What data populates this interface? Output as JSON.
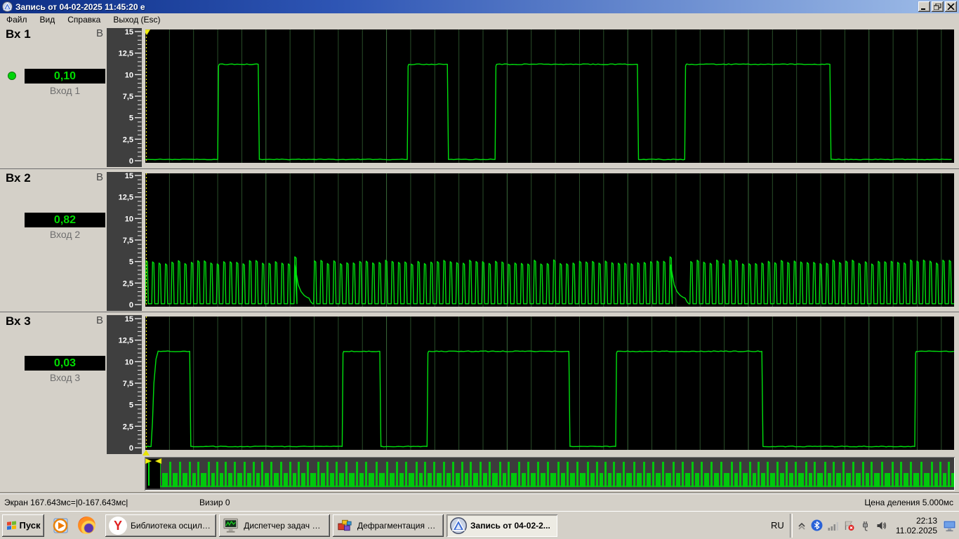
{
  "window": {
    "title": "Запись от 04-02-2025 11:45:20 е",
    "app_icon": "oscilloscope-app-icon",
    "buttons": [
      "minimize",
      "restore",
      "close"
    ]
  },
  "menu": {
    "items": [
      "Файл",
      "Вид",
      "Справка",
      "Выход (Esc)"
    ]
  },
  "status_bar": {
    "screen_info": "Экран 167.643мс=|0-167.643мс|",
    "cursor_info": "Визир 0",
    "division_info": "Цена деления 5.000мс"
  },
  "taskbar": {
    "start_label": "Пуск",
    "quick_launch": [
      "media-player-icon",
      "firefox-icon"
    ],
    "buttons": [
      {
        "label": "Библиотека осцилло...",
        "icon": "yandex-browser-icon",
        "active": false
      },
      {
        "label": "Диспетчер задач Wi...",
        "icon": "task-manager-icon",
        "active": false
      },
      {
        "label": "Дефрагментация ди...",
        "icon": "disk-defrag-icon",
        "active": false
      },
      {
        "label": "Запись от 04-02-2...",
        "icon": "oscilloscope-app-icon",
        "active": true
      }
    ],
    "tray": {
      "lang": "RU",
      "time": "22:13",
      "date": "11.02.2025"
    }
  },
  "icons": {
    "yandex_glyph": "Y"
  },
  "colors": {
    "wave_green": "#00e00e",
    "value_green": "#00dc00",
    "grid_green": "#294e29",
    "grid_green_major": "#3a6b3a",
    "scale_bg": "#3f3f3f",
    "plot_bg": "#000000",
    "cursor_yellow": "#f0ec10",
    "minimap_green": "#00c80c",
    "titlebar_left": "#0d2f86",
    "titlebar_right": "#9fbde8",
    "chrome_gray": "#d4d0c8"
  },
  "chart_data": {
    "type": "line",
    "title": "Запись от 04-02-2025 11:45:20 е",
    "time_window_ms": 167.643,
    "division_ms": 5.0,
    "x_range_label": "|0-167.643мс|",
    "cursor_position_ms": 0,
    "y_max": 15,
    "y_tick_values": [
      15,
      12.5,
      10,
      7.5,
      5,
      2.5,
      0
    ],
    "y_tick_labels": [
      "15",
      "12,5",
      "10",
      "7,5",
      "5",
      "2,5",
      "0"
    ],
    "grid": "vertical-only",
    "channels": [
      {
        "id": "Вх 1",
        "unit": "В",
        "value": "0,10",
        "label": "Вход 1",
        "active_dot": true,
        "wave": {
          "kind": "pulse",
          "base_v": 0.15,
          "high_v": 11.2,
          "pulses_ms": [
            [
              15.0,
              23.4
            ],
            [
              54.3,
              62.6
            ],
            [
              72.5,
              102.0
            ],
            [
              111.8,
              141.9
            ]
          ]
        }
      },
      {
        "id": "Вх 2",
        "unit": "В",
        "value": "0,82",
        "label": "Вход 2",
        "active_dot": false,
        "wave": {
          "kind": "teeth",
          "base_v": 0.1,
          "high_v": 5.0,
          "period_ms": 1.34,
          "gaps_ms": [
            [
              31.0,
              34.9
            ],
            [
              108.9,
              112.9
            ]
          ]
        }
      },
      {
        "id": "Вх 3",
        "unit": "В",
        "value": "0,03",
        "label": "Вход 3",
        "active_dot": false,
        "wave": {
          "kind": "pulse",
          "base_v": 0.15,
          "high_v": 11.2,
          "slow_rise_first": true,
          "pulses_ms": [
            [
              1.2,
              9.2
            ],
            [
              40.8,
              48.6
            ],
            [
              58.4,
              87.8
            ],
            [
              97.5,
              127.8
            ],
            [
              159.5,
              168.0
            ]
          ]
        }
      }
    ],
    "overview": {
      "window_start_ms": 0,
      "window_width_ms": 167.643
    }
  }
}
